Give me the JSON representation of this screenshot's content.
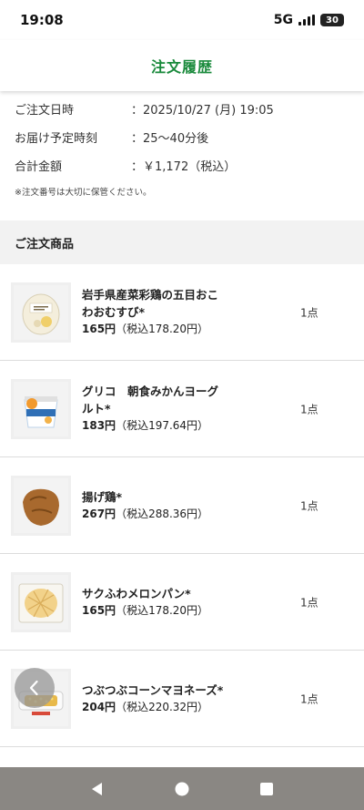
{
  "status_bar": {
    "time": "19:08",
    "network": "5G",
    "battery": "30"
  },
  "header": {
    "title": "注文履歴"
  },
  "order_info": {
    "rows": [
      {
        "label": "ご注文日時",
        "value": "：2025/10/27 (月) 19:05"
      },
      {
        "label": "お届け予定時刻",
        "value": "：25〜40分後"
      },
      {
        "label": "合計金額",
        "value": "：￥1,172（税込）"
      }
    ],
    "note": "※注文番号は大切に保管ください。"
  },
  "items_section": {
    "title": "ご注文商品",
    "items": [
      {
        "name": "岩手県産菜彩鶏の五目おこわおむすび*",
        "price": "165円",
        "tax_price": "（税込178.20円）",
        "qty": "1点",
        "thumb_icon": "onigiri-icon"
      },
      {
        "name": "グリコ　朝食みかんヨーグルト*",
        "price": "183円",
        "tax_price": "（税込197.64円）",
        "qty": "1点",
        "thumb_icon": "yogurt-icon"
      },
      {
        "name": "揚げ鶏*",
        "price": "267円",
        "tax_price": "（税込288.36円）",
        "qty": "1点",
        "thumb_icon": "fried-chicken-icon"
      },
      {
        "name": "サクふわメロンパン*",
        "price": "165円",
        "tax_price": "（税込178.20円）",
        "qty": "1点",
        "thumb_icon": "melon-pan-icon"
      },
      {
        "name": "つぶつぶコーンマヨネーズ*",
        "price": "204円",
        "tax_price": "（税込220.32円）",
        "qty": "1点",
        "thumb_icon": "corn-bread-icon"
      }
    ]
  },
  "colors": {
    "accent_green": "#1a8a3c",
    "nav_bar": "#8a8783",
    "section_bg": "#f2f2f2"
  },
  "nav_bar": {
    "icons": [
      "back-triangle-icon",
      "home-circle-icon",
      "recents-square-icon"
    ]
  }
}
